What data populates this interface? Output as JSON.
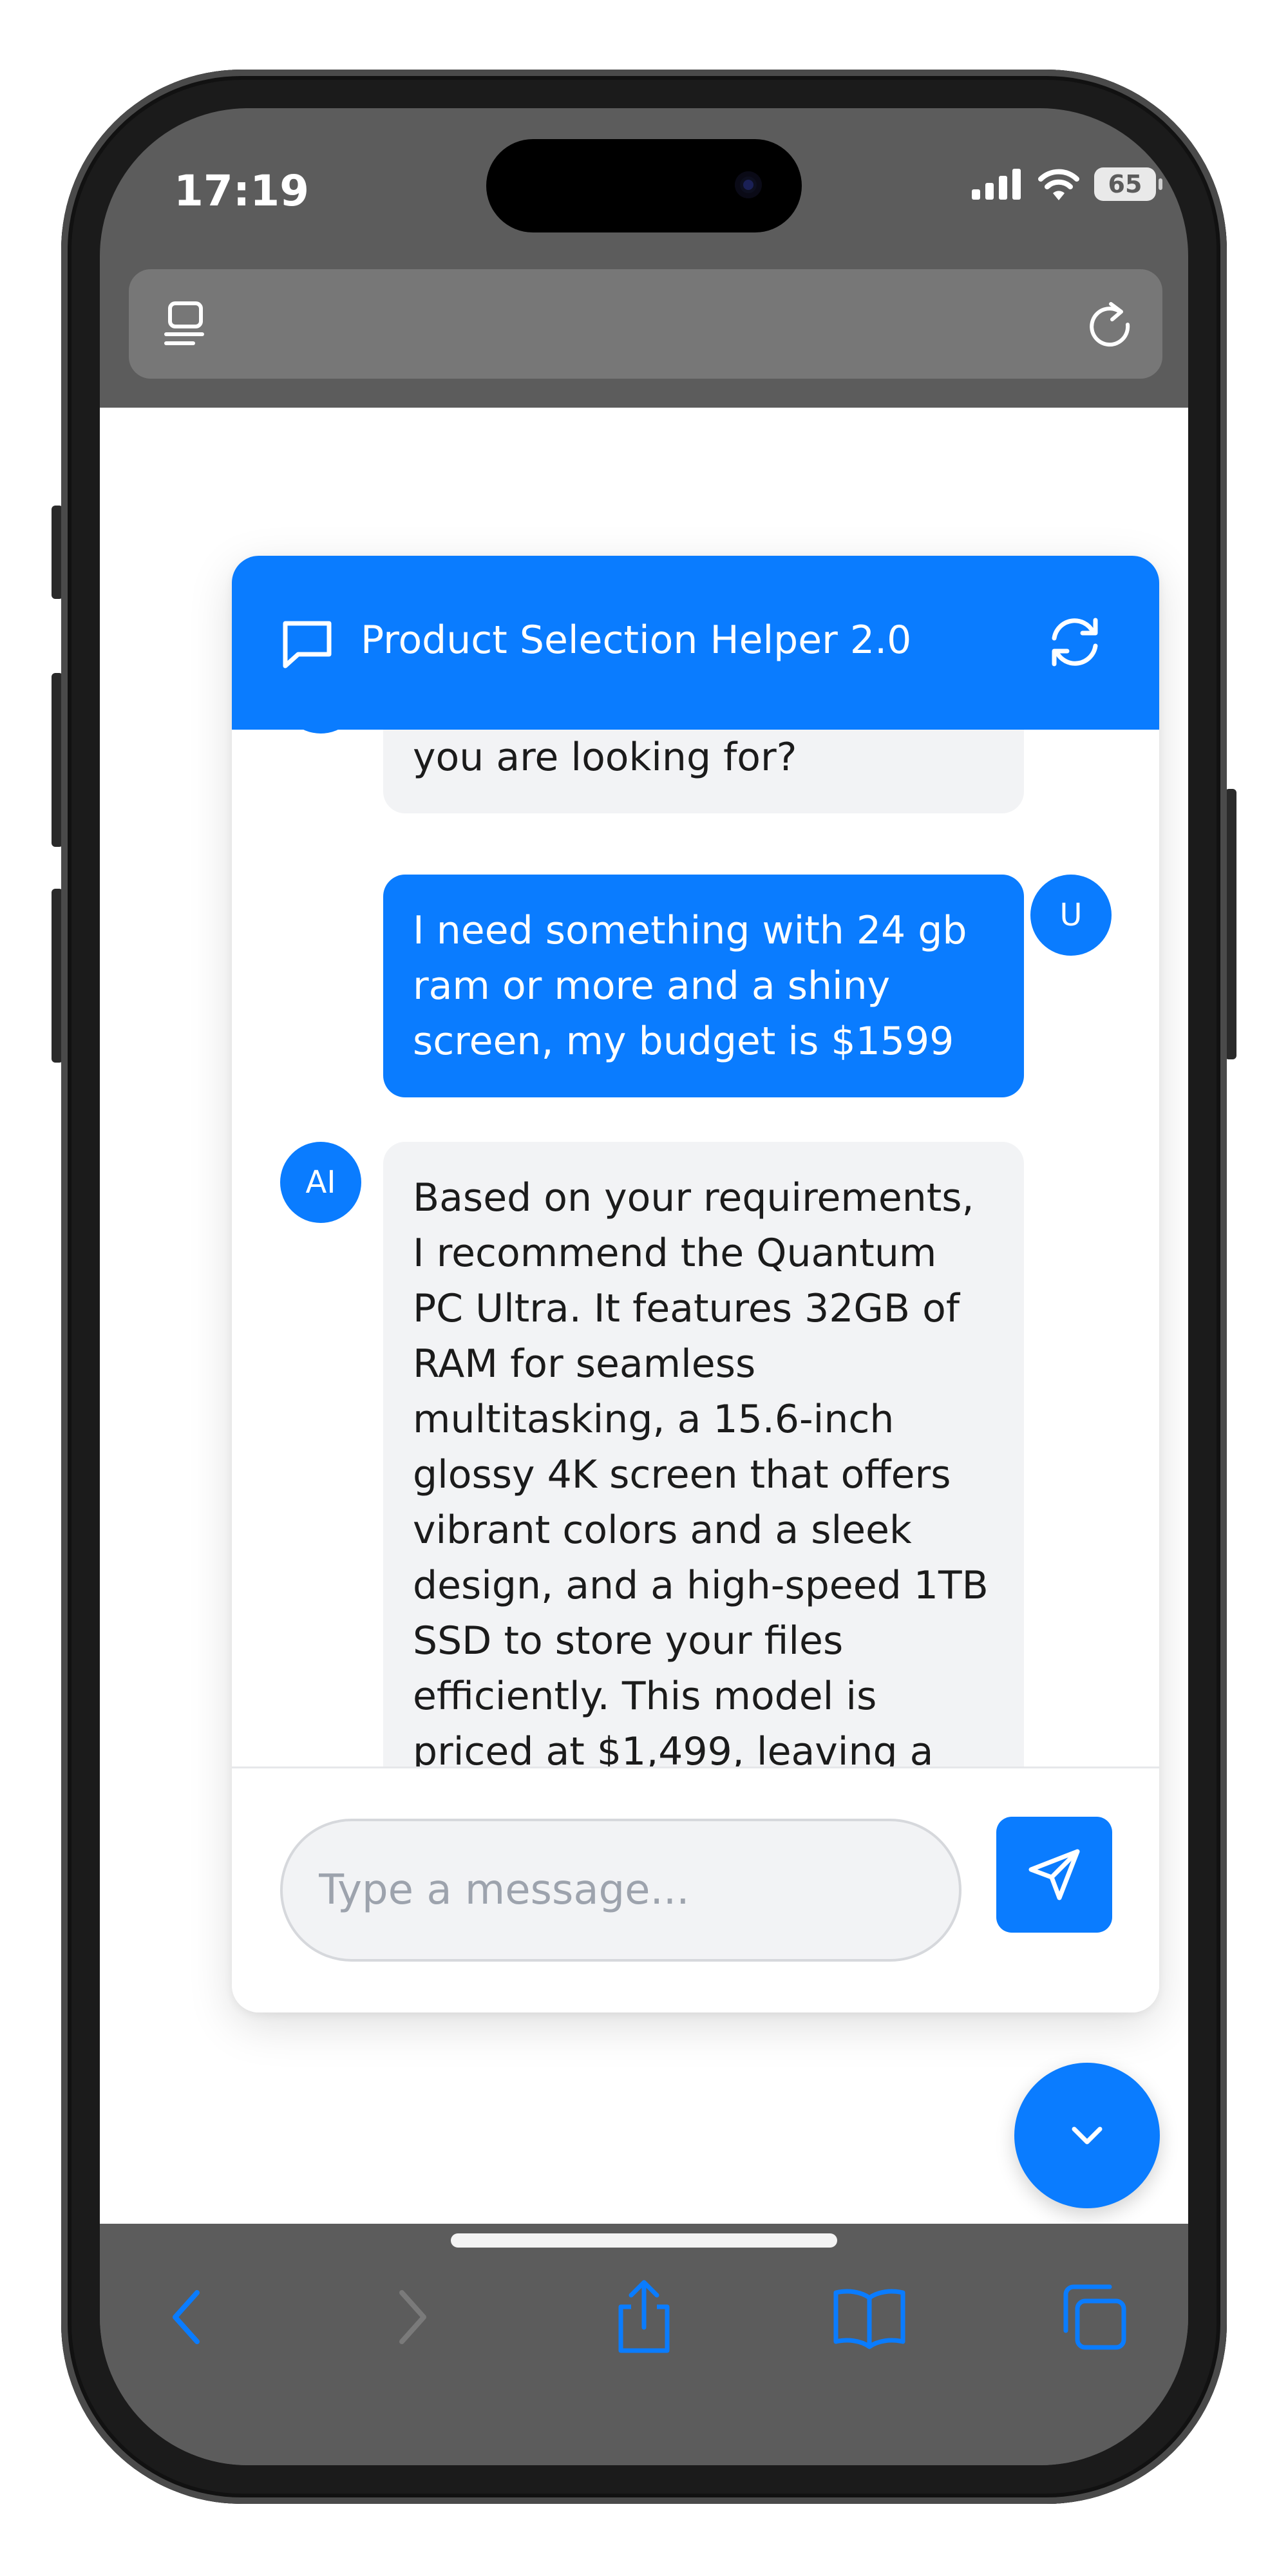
{
  "status_bar": {
    "time": "17:19",
    "battery": "65",
    "icons": [
      "cellular-signal-icon",
      "wifi-icon",
      "battery-icon"
    ]
  },
  "browser": {
    "url_text": "",
    "icons": {
      "left": "reader-view-icon",
      "right": "reload-icon"
    }
  },
  "chat": {
    "title": "Product Selection Helper 2.0",
    "header_icons": [
      "chat-bubble-icon",
      "refresh-icon"
    ],
    "messages": [
      {
        "role": "ai",
        "avatar": "AI",
        "text": "you are looking for?"
      },
      {
        "role": "user",
        "avatar": "U",
        "text": "I need something with 24 gb ram or more and a shiny screen, my budget is $1599"
      },
      {
        "role": "ai",
        "avatar": "AI",
        "text": "Based on your requirements, I recommend the Quantum PC Ultra. It features 32GB of RAM for seamless multitasking, a 15.6-inch glossy 4K screen that offers vibrant colors and a sleek design, and a high-speed 1TB SSD to store your files efficiently. This model is priced at $1,499, leaving a little room in your budget"
      }
    ],
    "input": {
      "placeholder": "Type a message...",
      "value": ""
    },
    "send_icon": "send-icon",
    "scroll_icon": "chevron-down-icon"
  },
  "toolbar": {
    "items": [
      "back-icon",
      "forward-icon",
      "share-icon",
      "bookmarks-icon",
      "tabs-icon"
    ]
  },
  "colors": {
    "accent": "#0a7cff",
    "ai_bubble": "#f2f3f5",
    "chrome": "#5c5c5c",
    "url_bar": "#777777"
  }
}
